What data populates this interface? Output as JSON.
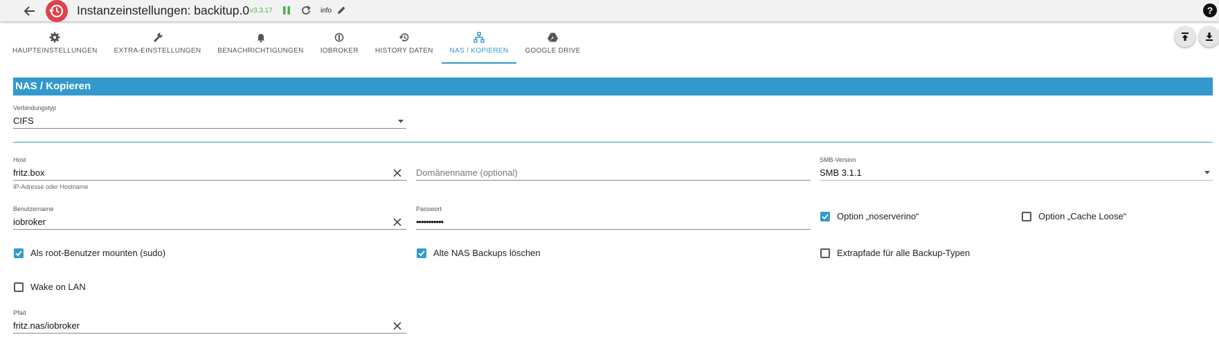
{
  "header": {
    "title": "Instanzeinstellungen: backitup.0",
    "version": "v3.3.17",
    "loglevel": "info",
    "help_label": "?"
  },
  "tabs": [
    {
      "label": "HAUPTEINSTELLUNGEN",
      "icon": "gear-icon"
    },
    {
      "label": "EXTRA-EINSTELLUNGEN",
      "icon": "wrench-icon"
    },
    {
      "label": "BENACHRICHTIGUNGEN",
      "icon": "bell-icon"
    },
    {
      "label": "IOBROKER",
      "icon": "iobroker-icon"
    },
    {
      "label": "HISTORY DATEN",
      "icon": "history-icon"
    },
    {
      "label": "NAS / KOPIEREN",
      "icon": "network-icon",
      "active": true
    },
    {
      "label": "GOOGLE DRIVE",
      "icon": "google-drive-icon"
    }
  ],
  "section": {
    "title": "NAS / Kopieren"
  },
  "form": {
    "connection_type": {
      "label": "Verbindungstyp",
      "value": "CIFS"
    },
    "host": {
      "label": "Host",
      "value": "fritz.box",
      "helper": "IP-Adresse oder Hostname"
    },
    "domain": {
      "placeholder": "Domänenname (optional)"
    },
    "smb_version": {
      "label": "SMB-Version",
      "value": "SMB 3.1.1"
    },
    "username": {
      "label": "Benutzername",
      "value": "iobroker"
    },
    "password": {
      "label": "Passwort",
      "value": "•••••••••••"
    },
    "path": {
      "label": "Pfad",
      "value": "fritz.nas/iobroker"
    }
  },
  "checkboxes": {
    "noserverino": {
      "label": "Option „noserverino“",
      "checked": true
    },
    "cache_loose": {
      "label": "Option „Cache Loose“",
      "checked": false
    },
    "sudo": {
      "label": "Als root-Benutzer mounten (sudo)",
      "checked": true
    },
    "delete_old": {
      "label": "Alte NAS Backups löschen",
      "checked": true
    },
    "extra_paths": {
      "label": "Extrapfade für alle Backup-Typen",
      "checked": false
    },
    "wol": {
      "label": "Wake on LAN",
      "checked": false
    }
  },
  "colors": {
    "accent": "#3399cc",
    "logo": "#e2404a",
    "version": "#4caf50"
  }
}
